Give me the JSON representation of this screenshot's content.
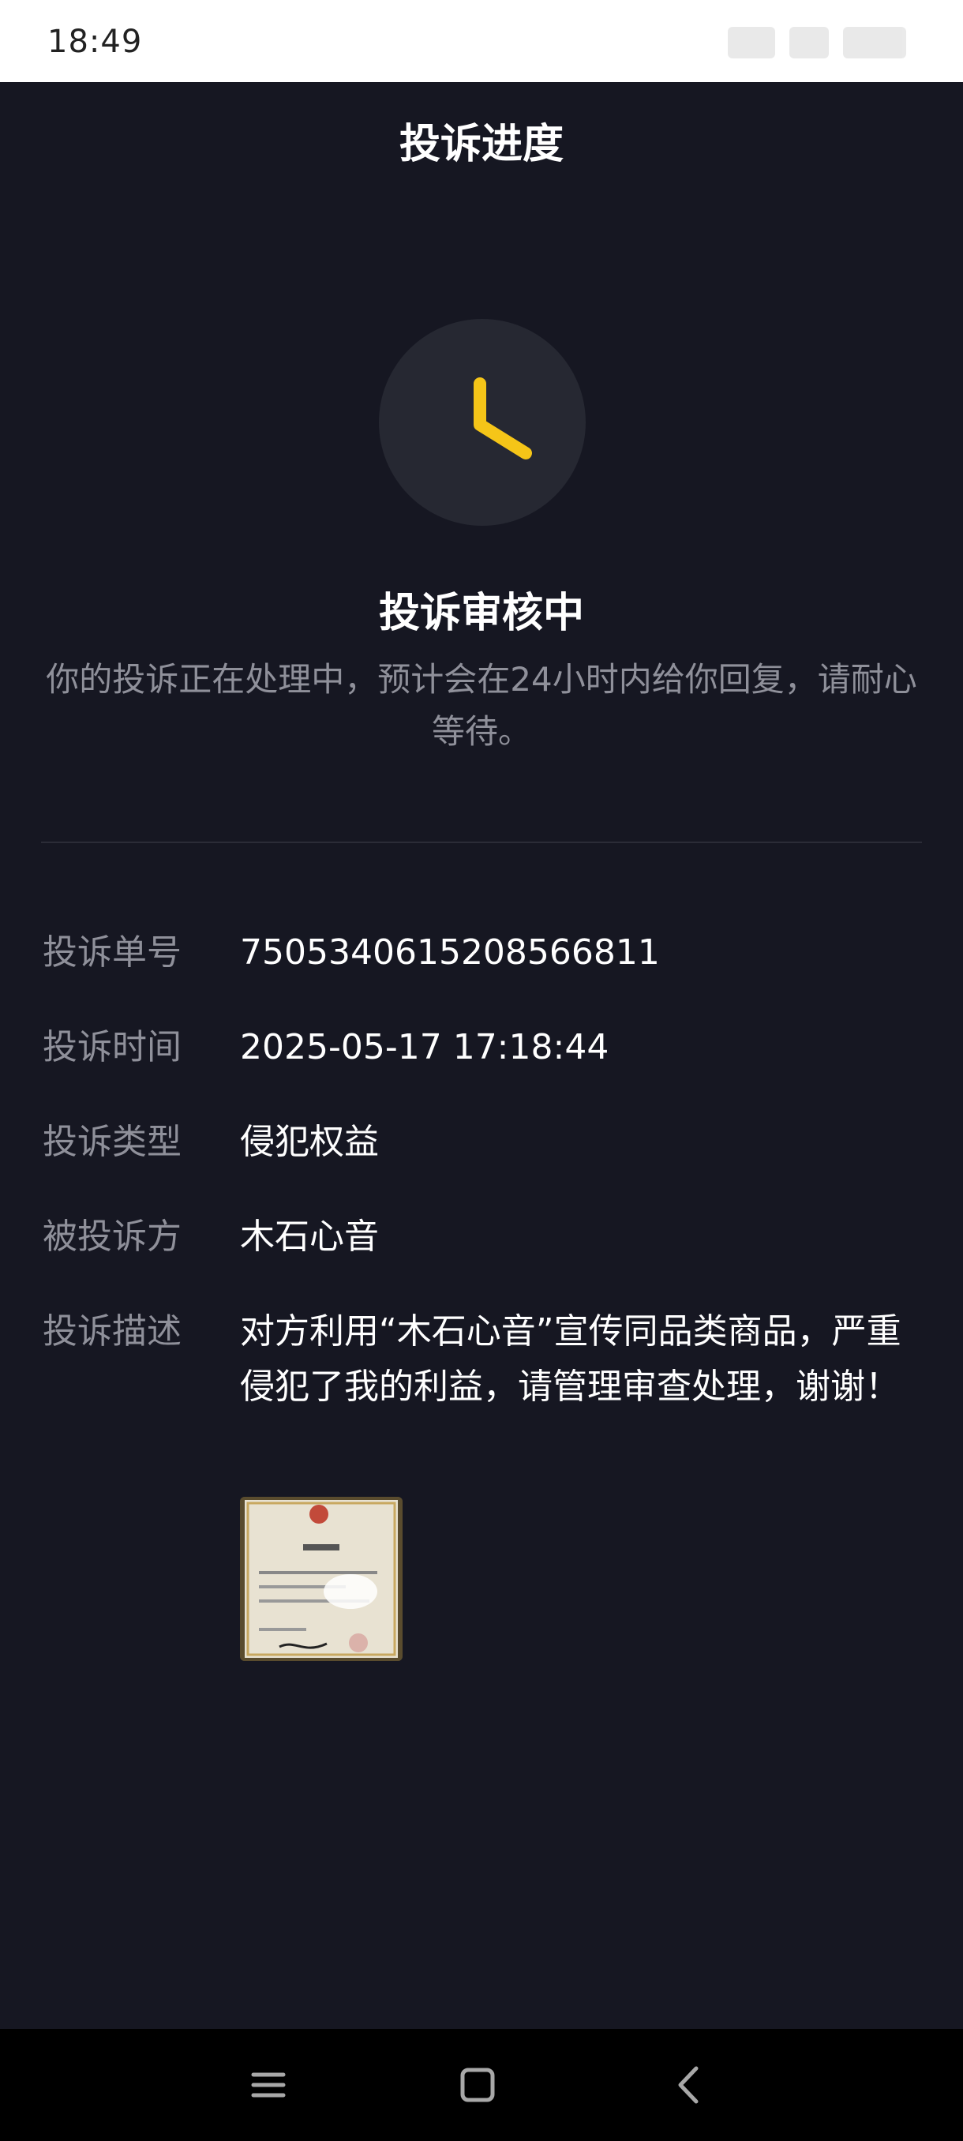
{
  "status_bar": {
    "time": "18:49"
  },
  "header": {
    "title": "投诉进度"
  },
  "status": {
    "icon": "clock-icon",
    "title": "投诉审核中",
    "description": "你的投诉正在处理中，预计会在24小时内给你回复，请耐心等待。"
  },
  "details": {
    "id_label": "投诉单号",
    "id_value": "7505340615208566811",
    "time_label": "投诉时间",
    "time_value": "2025-05-17 17:18:44",
    "type_label": "投诉类型",
    "type_value": "侵犯权益",
    "target_label": "被投诉方",
    "target_value": "木石心音",
    "desc_label": "投诉描述",
    "desc_value": "对方利用“木石心音”宣传同品类商品，严重侵犯了我的利益，请管理审查处理，谢谢！",
    "attachment_icon": "certificate-photo-thumbnail"
  },
  "navbar": {
    "menu_icon": "menu-icon",
    "home_icon": "home-square-icon",
    "back_icon": "back-chevron-icon"
  },
  "colors": {
    "background": "#161722",
    "accent": "#f5c518",
    "text_primary": "#ffffff",
    "text_secondary": "#8f909a"
  }
}
